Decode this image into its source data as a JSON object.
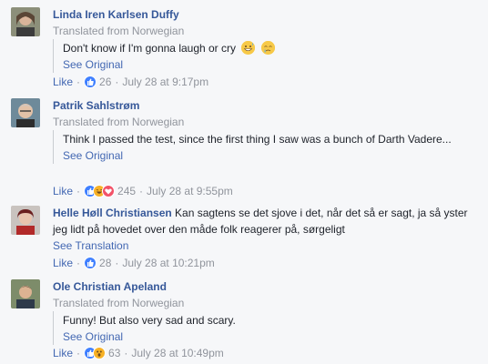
{
  "comments": [
    {
      "author": "Linda Iren Karlsen Duffy",
      "translated": "Translated from Norwegian",
      "text": "Don't know if I'm gonna laugh or cry",
      "emojis": [
        "grinning-sweat-emoji",
        "crying-emoji"
      ],
      "see_link": "See Original",
      "like": "Like",
      "reactions": [
        "like"
      ],
      "count": "26",
      "timestamp": "July 28 at 9:17pm"
    },
    {
      "author": "Patrik Sahlstrøm",
      "translated": "Translated from Norwegian",
      "text": "Think I passed the test, since the first thing I saw was a bunch of Darth Vadere...",
      "see_link": "See Original",
      "like": "Like",
      "reactions": [
        "like",
        "haha",
        "love"
      ],
      "count": "245",
      "timestamp": "July 28 at 9:55pm"
    },
    {
      "author": "Helle Høll Christiansen",
      "text": "Kan sagtens se det sjove i det, når det så er sagt, ja så yster jeg lidt på hovedet over den måde folk reagerer på, sørgeligt",
      "see_link": "See Translation",
      "like": "Like",
      "reactions": [
        "like"
      ],
      "count": "28",
      "timestamp": "July 28 at 10:21pm"
    },
    {
      "author": "Ole Christian Apeland",
      "translated": "Translated from Norwegian",
      "text": "Funny! But also very sad and scary.",
      "see_link": "See Original",
      "like": "Like",
      "reactions": [
        "like",
        "wow"
      ],
      "count": "63",
      "timestamp": "July 28 at 10:49pm"
    }
  ],
  "colors": {
    "name": "#365899",
    "link": "#4267b2",
    "muted": "#90949c",
    "like": "#4080ff",
    "haha": "#f7b125",
    "love": "#f25268"
  }
}
